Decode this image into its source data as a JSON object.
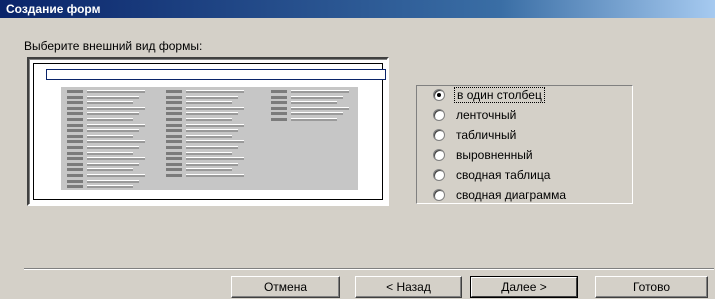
{
  "window": {
    "title": "Создание форм"
  },
  "prompt": "Выберите внешний вид формы:",
  "layout_options": [
    {
      "label": "в один столбец",
      "selected": true
    },
    {
      "label": "ленточный",
      "selected": false
    },
    {
      "label": "табличный",
      "selected": false
    },
    {
      "label": "выровненный",
      "selected": false
    },
    {
      "label": "сводная таблица",
      "selected": false
    },
    {
      "label": "сводная диаграмма",
      "selected": false
    }
  ],
  "buttons": {
    "cancel": "Отмена",
    "back": "< Назад",
    "next": "Далее >",
    "finish": "Готово"
  },
  "colors": {
    "titlebar": "#0a246a",
    "face": "#d4d0c8"
  }
}
